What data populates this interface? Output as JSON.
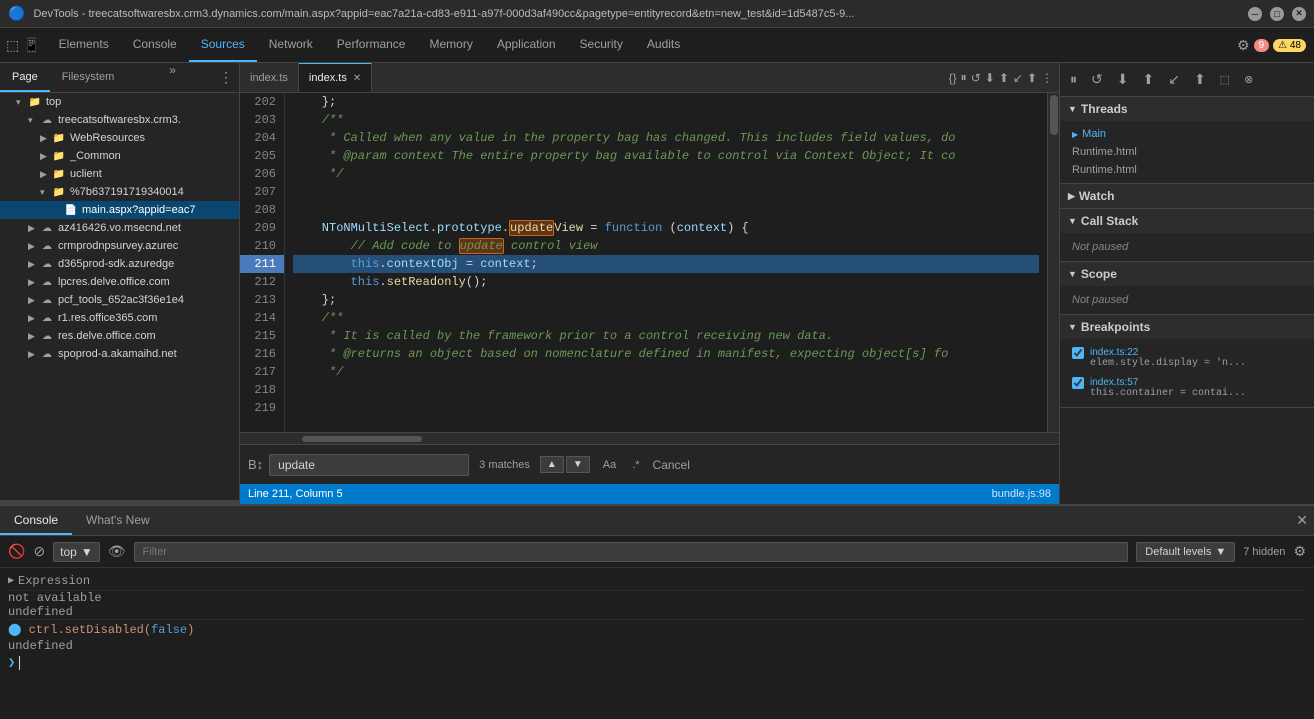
{
  "titleBar": {
    "title": "DevTools - treecatsoftwaresbx.crm3.dynamics.com/main.aspx?appid=eac7a21a-cd83-e911-a97f-000d3af490cc&pagetype=entityrecord&etn=new_test&id=1d5487c5-9..."
  },
  "topNav": {
    "tabs": [
      "Elements",
      "Console",
      "Sources",
      "Network",
      "Performance",
      "Memory",
      "Application",
      "Security",
      "Audits"
    ],
    "activeTab": "Sources",
    "errorCount": "9",
    "warnCount": "48"
  },
  "sourcesSidebar": {
    "tabs": [
      "Page",
      "Filesystem"
    ],
    "tree": [
      {
        "label": "top",
        "level": 0,
        "type": "root",
        "expanded": true
      },
      {
        "label": "treecatsoftwaresbx.crm3.",
        "level": 1,
        "type": "domain",
        "expanded": true
      },
      {
        "label": "WebResources",
        "level": 2,
        "type": "folder",
        "expanded": false
      },
      {
        "label": "_Common",
        "level": 2,
        "type": "folder",
        "expanded": false
      },
      {
        "label": "uclient",
        "level": 2,
        "type": "folder",
        "expanded": false
      },
      {
        "label": "%7b637191719340014",
        "level": 2,
        "type": "folder",
        "expanded": true
      },
      {
        "label": "main.aspx?appid=eac7",
        "level": 3,
        "type": "file",
        "selected": true
      },
      {
        "label": "az416426.vo.msecnd.net",
        "level": 1,
        "type": "domain",
        "expanded": false
      },
      {
        "label": "crmprodnpsurvey.azurec",
        "level": 1,
        "type": "domain",
        "expanded": false
      },
      {
        "label": "d365prod-sdk.azuredge",
        "level": 1,
        "type": "domain",
        "expanded": false
      },
      {
        "label": "lpcres.delve.office.com",
        "level": 1,
        "type": "domain",
        "expanded": false
      },
      {
        "label": "pcf_tools_652ac3f36e1e4",
        "level": 1,
        "type": "domain",
        "expanded": false
      },
      {
        "label": "r1.res.office365.com",
        "level": 1,
        "type": "domain",
        "expanded": false
      },
      {
        "label": "res.delve.office.com",
        "level": 1,
        "type": "domain",
        "expanded": false
      },
      {
        "label": "spoprod-a.akamaihd.net",
        "level": 1,
        "type": "domain",
        "expanded": false
      }
    ]
  },
  "codeTabs": [
    {
      "label": "index.ts",
      "active": false
    },
    {
      "label": "index.ts",
      "active": true,
      "modified": true
    }
  ],
  "codeLines": [
    {
      "num": 202,
      "content": "    };"
    },
    {
      "num": 203,
      "content": "    /**"
    },
    {
      "num": 204,
      "content": "     * Called when any value in the property bag has changed. This includes field values, do"
    },
    {
      "num": 205,
      "content": "     * @param context The entire property bag available to control via Context Object; It co"
    },
    {
      "num": 206,
      "content": "     */"
    },
    {
      "num": 207,
      "content": ""
    },
    {
      "num": 208,
      "content": ""
    },
    {
      "num": 209,
      "content": "    NToNMultiSelect.prototype.updateView = function (context) {"
    },
    {
      "num": 210,
      "content": "        // Add code to update control view"
    },
    {
      "num": 211,
      "content": "        this.contextObj = context;",
      "highlighted": true
    },
    {
      "num": 212,
      "content": "        this.setReadonly();"
    },
    {
      "num": 213,
      "content": "    };"
    },
    {
      "num": 214,
      "content": "    /**"
    },
    {
      "num": 215,
      "content": "     * It is called by the framework prior to a control receiving new data."
    },
    {
      "num": 216,
      "content": "     * @returns an object based on nomenclature defined in manifest, expecting object[s] fo"
    },
    {
      "num": 217,
      "content": "     */"
    },
    {
      "num": 218,
      "content": ""
    },
    {
      "num": 219,
      "content": ""
    }
  ],
  "searchBar": {
    "query": "update",
    "matchCount": "3 matches",
    "caseSensitiveLabel": "Aa",
    "regexLabel": ".*",
    "cancelLabel": "Cancel"
  },
  "statusBar": {
    "position": "Line 211, Column 5",
    "file": "bundle.js:98"
  },
  "rightPanel": {
    "debugButtons": [
      "⏸",
      "↺",
      "⬇",
      "⬆",
      "↙",
      "⬆"
    ],
    "threads": {
      "title": "Threads",
      "items": [
        "Main",
        "Runtime.html",
        "Runtime.html"
      ]
    },
    "watch": {
      "title": "Watch"
    },
    "callStack": {
      "title": "Call Stack",
      "status": "Not paused"
    },
    "scope": {
      "title": "Scope",
      "status": "Not paused"
    },
    "breakpoints": {
      "title": "Breakpoints",
      "items": [
        {
          "file": "index.ts:22",
          "code": "elem.style.display = 'n..."
        },
        {
          "file": "index.ts:57",
          "code": "this.container = contai..."
        }
      ]
    }
  },
  "console": {
    "tabs": [
      "Console",
      "What's New"
    ],
    "toolbar": {
      "context": "top",
      "filterPlaceholder": "Filter",
      "levelsLabel": "Default levels",
      "hiddenCount": "7 hidden"
    },
    "lines": [
      {
        "type": "expr",
        "text": "Expression"
      },
      {
        "type": "value",
        "text": "not available"
      },
      {
        "type": "value",
        "text": "undefined"
      },
      {
        "type": "code",
        "text": "ctrl.setDisabled(false)"
      },
      {
        "type": "value",
        "text": "undefined"
      }
    ]
  }
}
